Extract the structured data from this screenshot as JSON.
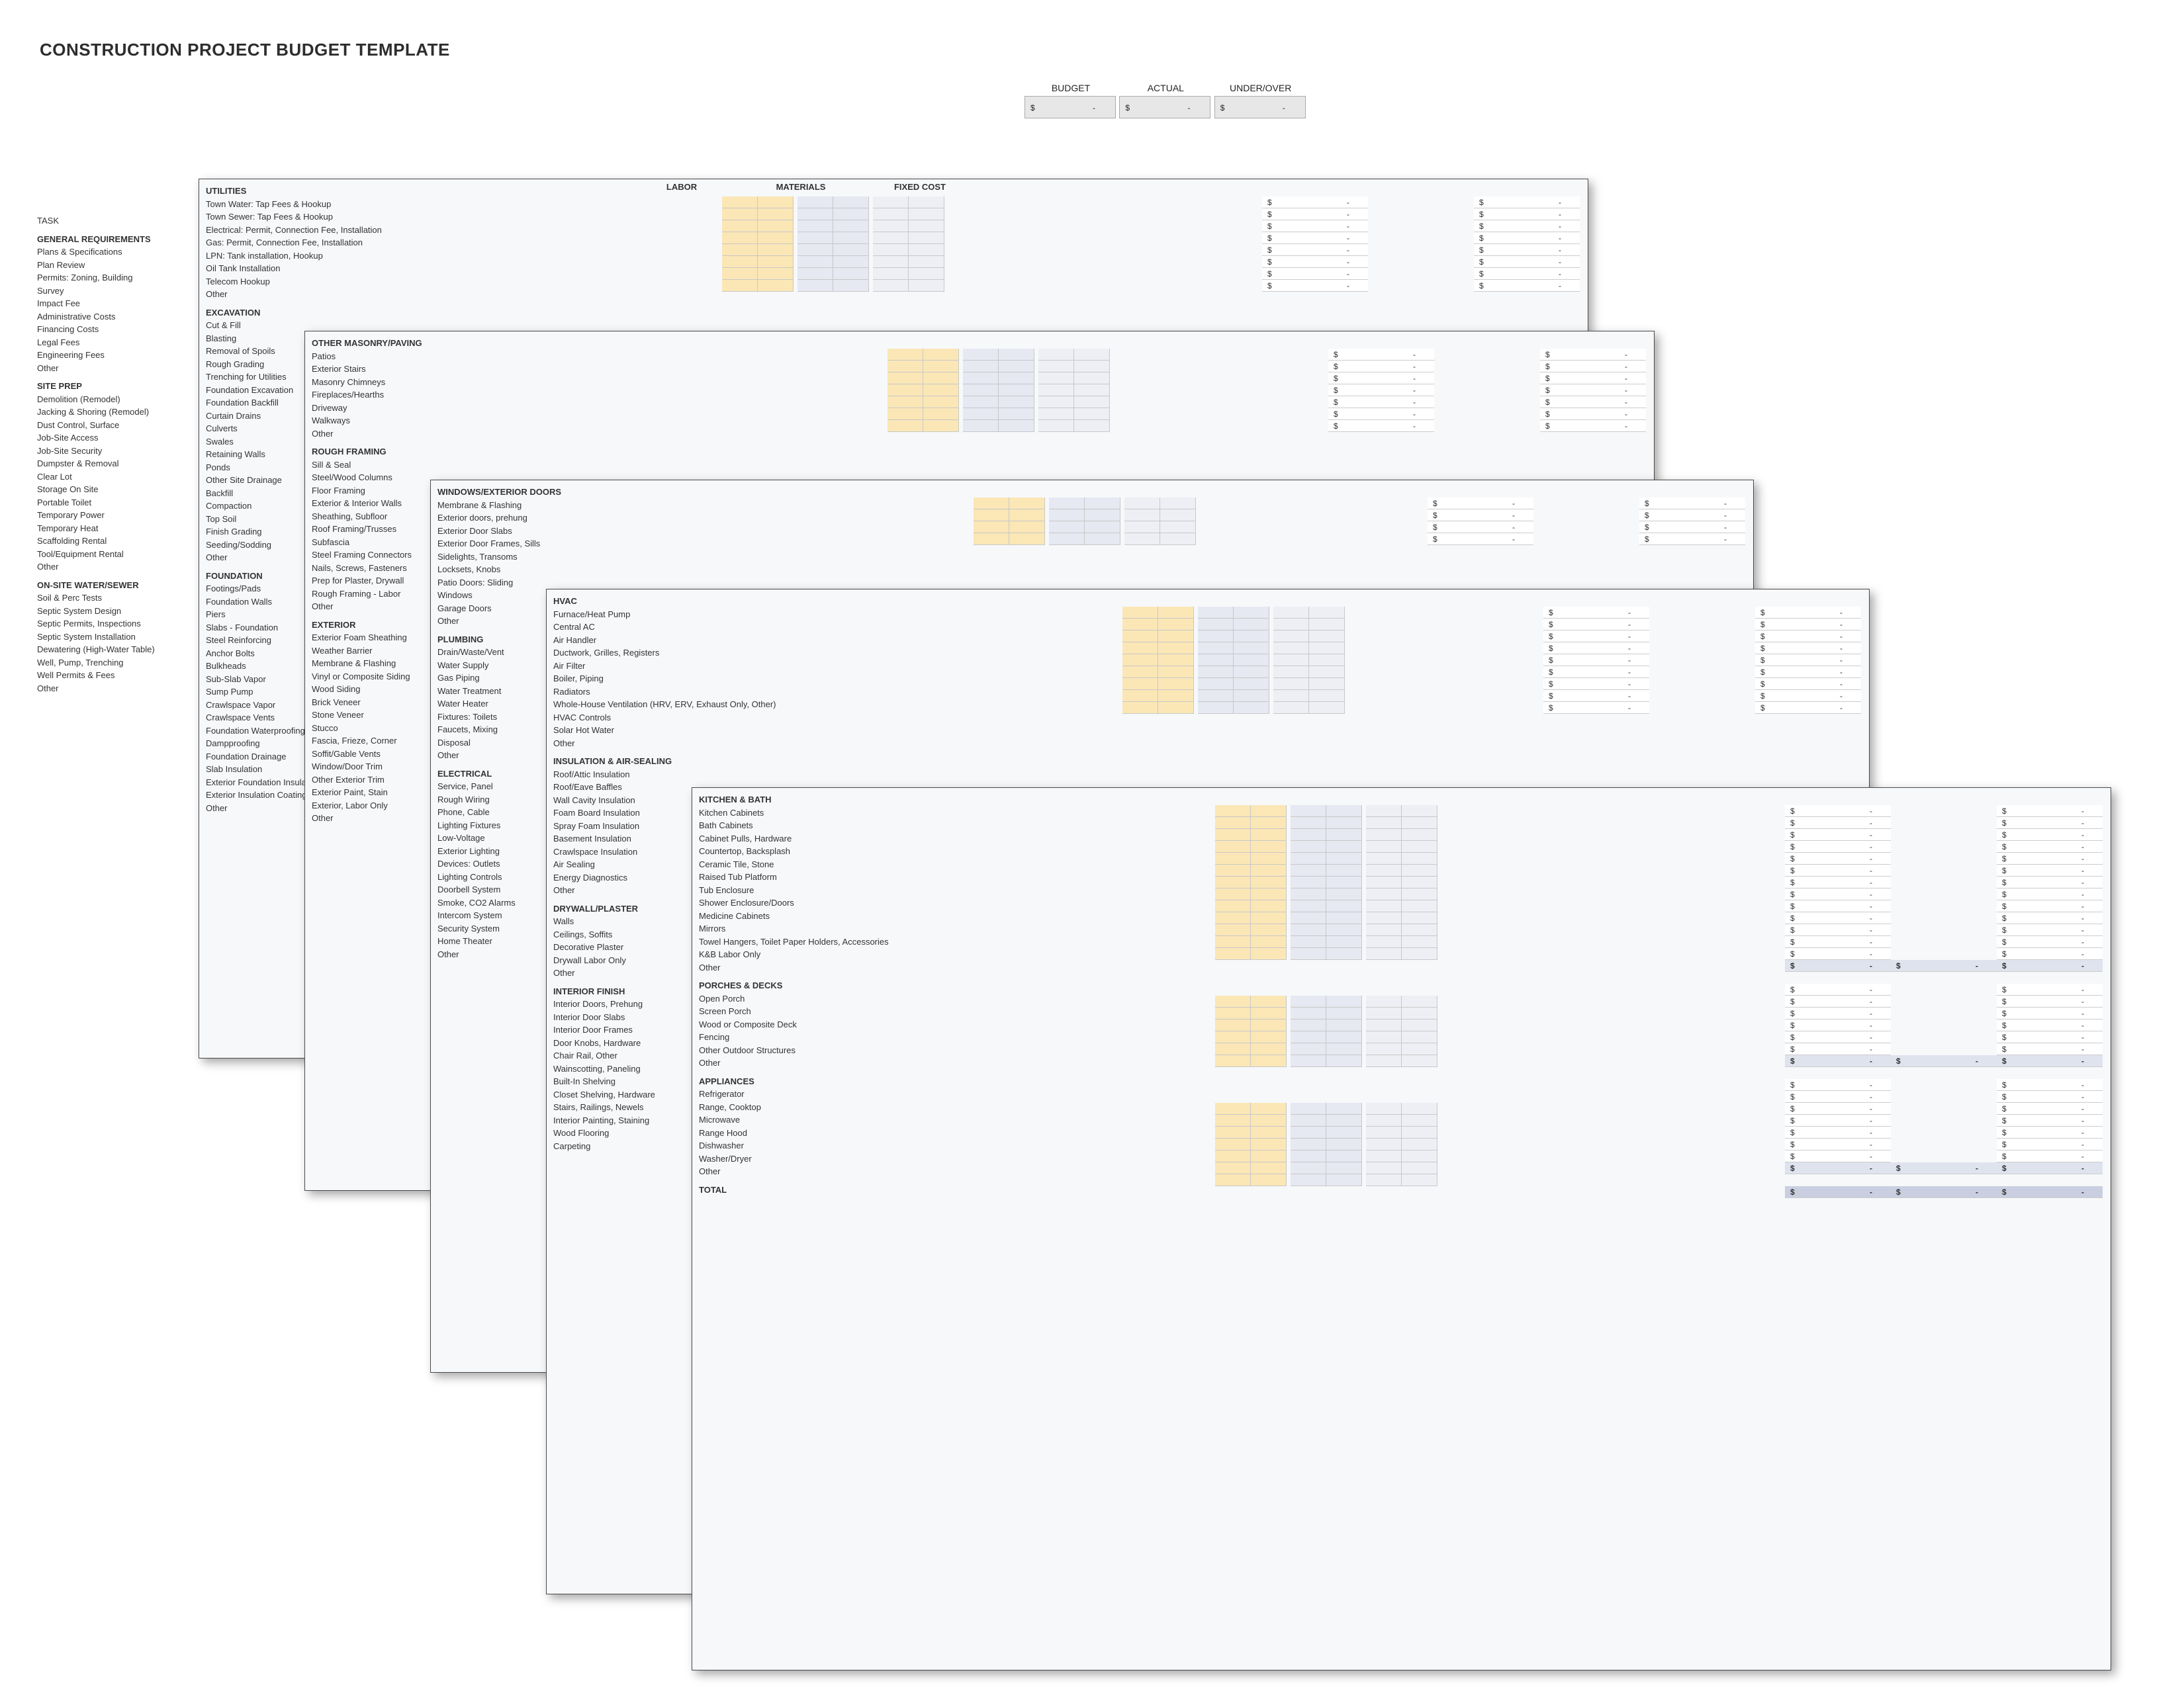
{
  "title": "CONSTRUCTION PROJECT BUDGET TEMPLATE",
  "summary_labels": {
    "budget": "BUDGET",
    "actual": "ACTUAL",
    "under": "UNDER/OVER"
  },
  "summary_values": {
    "budget_sym": "$",
    "budget_dash": "-",
    "actual_sym": "$",
    "actual_dash": "-",
    "under_sym": "$",
    "under_dash": "-"
  },
  "column_headers": {
    "labor": "LABOR",
    "materials": "MATERIALS",
    "fixed": "FIXED COST"
  },
  "money": {
    "sym": "$",
    "dash": "-"
  },
  "layer1": {
    "task_header": "TASK",
    "sections": [
      {
        "heading": "GENERAL REQUIREMENTS",
        "rows": [
          "Plans & Specifications",
          "Plan Review",
          "Permits: Zoning, Building",
          "Survey",
          "Impact Fee",
          "Administrative Costs",
          "Financing Costs",
          "Legal Fees",
          "Engineering Fees",
          "Other"
        ]
      },
      {
        "heading": "SITE PREP",
        "rows": [
          "Demolition (Remodel)",
          "Jacking & Shoring (Remodel)",
          "Dust Control, Surface",
          "Job-Site Access",
          "Job-Site Security",
          "Dumpster & Removal",
          "Clear Lot",
          "Storage On Site",
          "Portable Toilet",
          "Temporary Power",
          "Temporary Heat",
          "Scaffolding Rental",
          "Tool/Equipment Rental",
          "Other"
        ]
      },
      {
        "heading": "ON-SITE WATER/SEWER",
        "rows": [
          "Soil & Perc Tests",
          "Septic System Design",
          "Septic Permits, Inspections",
          "Septic System Installation",
          "Dewatering (High-Water Table)",
          "Well, Pump, Trenching",
          "Well Permits & Fees",
          "Other"
        ]
      }
    ]
  },
  "layer2": {
    "sections": [
      {
        "heading": "UTILITIES",
        "rows": [
          "Town Water: Tap Fees & Hookup",
          "Town Sewer: Tap Fees & Hookup",
          "Electrical: Permit, Connection Fee, Installation",
          "Gas: Permit, Connection Fee, Installation",
          "LPN: Tank installation, Hookup",
          "Oil Tank Installation",
          "Telecom Hookup",
          "Other"
        ]
      },
      {
        "heading": "EXCAVATION",
        "rows": [
          "Cut & Fill",
          "Blasting",
          "Removal of Spoils",
          "Rough Grading",
          "Trenching for Utilities",
          "Foundation Excavation",
          "Foundation Backfill",
          "Curtain Drains",
          "Culverts",
          "Swales",
          "Retaining Walls",
          "Ponds",
          "Other Site Drainage",
          "Backfill",
          "Compaction",
          "Top Soil",
          "Finish Grading",
          "Seeding/Sodding",
          "Other"
        ]
      },
      {
        "heading": "FOUNDATION",
        "rows": [
          "Footings/Pads",
          "Foundation Walls",
          "Piers",
          "Slabs - Foundation",
          "Steel Reinforcing",
          "Anchor Bolts",
          "Bulkheads",
          "Sub-Slab Vapor",
          "Sump Pump",
          "Crawlspace Vapor",
          "Crawlspace Vents",
          "Foundation Waterproofing",
          "Dampproofing",
          "Foundation Drainage",
          "Slab Insulation",
          "Exterior Foundation Insulation",
          "Exterior Insulation Coating/ Protection",
          "Other"
        ]
      }
    ],
    "money_rows_first_section": 8
  },
  "layer3": {
    "sections": [
      {
        "heading": "ROUGH FRAMING",
        "rows": [
          "Sill & Seal",
          "Steel/Wood Columns",
          "Floor Framing",
          "Exterior & Interior Walls",
          "Sheathing, Subfloor",
          "Roof Framing/Trusses",
          "Subfascia",
          "Steel Framing Connectors",
          "Nails, Screws, Fasteners",
          "Prep for Plaster, Drywall",
          "Rough Framing - Labor",
          "Other"
        ]
      },
      {
        "heading": "EXTERIOR",
        "rows": [
          "Exterior Foam Sheathing",
          "Weather Barrier",
          "Membrane & Flashing",
          "Vinyl or Composite Siding",
          "Wood Siding",
          "Brick Veneer",
          "Stone Veneer",
          "Stucco",
          "Fascia, Frieze, Corner",
          "Soffit/Gable Vents",
          "Window/Door Trim",
          "Other Exterior Trim",
          "Exterior Paint, Stain",
          "Exterior, Labor Only",
          "Other"
        ]
      }
    ],
    "pre_heading": "OTHER MASONRY/PAVING",
    "pre_rows": [
      "Patios",
      "Exterior Stairs",
      "Masonry Chimneys",
      "Fireplaces/Hearths",
      "Driveway",
      "Walkways",
      "Other"
    ]
  },
  "layer4": {
    "pre_heading": "WINDOWS/EXTERIOR DOORS",
    "pre_rows": [
      "Membrane & Flashing",
      "Exterior doors, prehung",
      "Exterior Door Slabs",
      "Exterior Door Frames, Sills",
      "Sidelights, Transoms",
      "Locksets, Knobs",
      "Patio Doors: Sliding",
      "Windows",
      "Garage Doors",
      "Other"
    ],
    "sections": [
      {
        "heading": "PLUMBING",
        "rows": [
          "Drain/Waste/Vent",
          "Water Supply",
          "Gas Piping",
          "Water Treatment",
          "Water Heater",
          "Fixtures: Toilets",
          "Faucets, Mixing",
          "Disposal",
          "Other"
        ]
      },
      {
        "heading": "ELECTRICAL",
        "rows": [
          "Service, Panel",
          "Rough Wiring",
          "Phone, Cable",
          "Lighting Fixtures",
          "Low-Voltage",
          "Exterior Lighting",
          "Devices: Outlets",
          "Lighting Controls",
          "Doorbell System",
          "Smoke, CO2 Alarms",
          "Intercom System",
          "Security System",
          "Home Theater",
          "Other"
        ]
      }
    ]
  },
  "layer5": {
    "pre_heading": "HVAC",
    "pre_rows": [
      "Furnace/Heat Pump",
      "Central AC",
      "Air Handler",
      "Ductwork, Grilles, Registers",
      "Air Filter",
      "Boiler, Piping",
      "Radiators",
      "Whole-House Ventilation (HRV, ERV, Exhaust Only, Other)",
      "HVAC Controls",
      "Solar Hot Water",
      "Other"
    ],
    "sections": [
      {
        "heading": "INSULATION & AIR-SEALING",
        "rows": [
          "Roof/Attic Insulation",
          "Roof/Eave Baffles",
          "Wall Cavity Insulation",
          "Foam Board Insulation",
          "Spray Foam Insulation",
          "Basement Insulation",
          "Crawlspace Insulation",
          "Air Sealing",
          "Energy Diagnostics",
          "Other"
        ]
      },
      {
        "heading": "DRYWALL/PLASTER",
        "rows": [
          "Walls",
          "Ceilings, Soffits",
          "Decorative Plaster",
          "Drywall Labor Only",
          "Other"
        ]
      },
      {
        "heading": "INTERIOR FINISH",
        "rows": [
          "Interior Doors, Prehung",
          "Interior Door Slabs",
          "Interior Door Frames",
          "Door Knobs, Hardware",
          "Chair Rail, Other",
          "Wainscotting, Paneling",
          "Built-In Shelving",
          "Closet Shelving, Hardware",
          "Stairs, Railings, Newels",
          "Interior Painting, Staining",
          "Wood Flooring",
          "Carpeting"
        ]
      }
    ]
  },
  "layer6": {
    "sections": [
      {
        "heading": "KITCHEN & BATH",
        "rows": [
          "Kitchen Cabinets",
          "Bath Cabinets",
          "Cabinet Pulls, Hardware",
          "Countertop, Backsplash",
          "Ceramic Tile, Stone",
          "Raised Tub Platform",
          "Tub Enclosure",
          "Shower Enclosure/Doors",
          "Medicine Cabinets",
          "Mirrors",
          "Towel Hangers, Toilet Paper Holders, Accessories",
          "K&B Labor Only",
          "Other"
        ],
        "subtotal": true
      },
      {
        "heading": "PORCHES & DECKS",
        "rows": [
          "Open Porch",
          "Screen Porch",
          "Wood or Composite Deck",
          "Fencing",
          "Other Outdoor Structures",
          "Other"
        ],
        "subtotal": true
      },
      {
        "heading": "APPLIANCES",
        "rows": [
          "Refrigerator",
          "Range, Cooktop",
          "Microwave",
          "Range Hood",
          "Dishwasher",
          "Washer/Dryer",
          "Other"
        ],
        "subtotal": true
      }
    ],
    "total_label": "TOTAL"
  }
}
